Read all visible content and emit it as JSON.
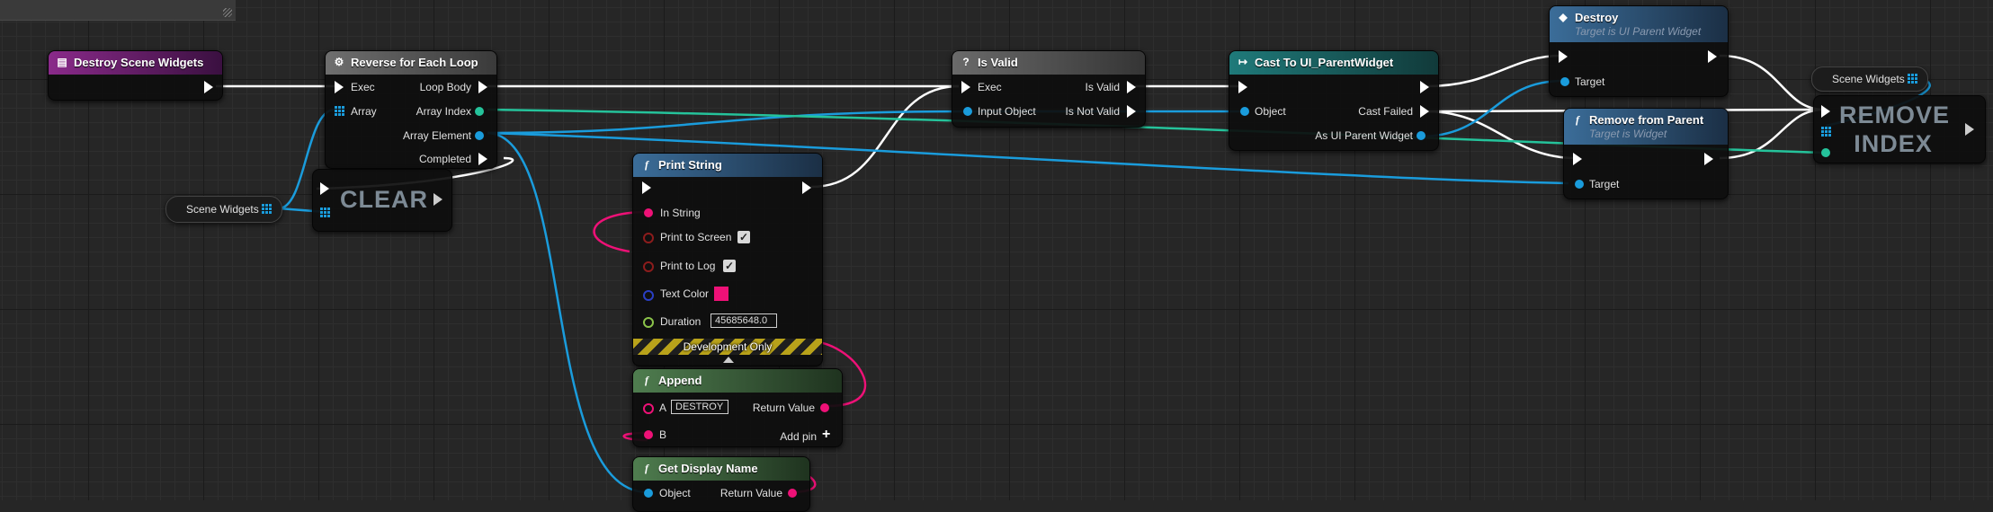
{
  "colors": {
    "event_header": "#7a1d7a",
    "function_header": "#2f5f88",
    "macro_header": "#666666",
    "pure_header": "#4a7a4a",
    "cast_header": "#1c6f6f",
    "object_pin": "#1a9cdc",
    "int_pin": "#25c39b",
    "string_pin": "#ee1177",
    "bool_pin": "#8c1c1c",
    "color_pin": "#2a3fc4",
    "float_pin": "#8bc34a"
  },
  "graph": {
    "destroy_event": {
      "title": "Destroy Scene Widgets",
      "icon": "event-icon"
    },
    "foreach": {
      "title": "Reverse for Each Loop",
      "icon": "macro-icon",
      "exec": "Exec",
      "array": "Array",
      "loop_body": "Loop Body",
      "array_index": "Array Index",
      "array_element": "Array Element",
      "completed": "Completed"
    },
    "scene_widgets_get": {
      "label": "Scene Widgets"
    },
    "clear": {
      "label": "CLEAR"
    },
    "is_valid": {
      "title": "Is Valid",
      "icon": "?",
      "exec": "Exec",
      "input_object": "Input Object",
      "out_valid": "Is Valid",
      "out_invalid": "Is Not Valid"
    },
    "cast": {
      "title": "Cast To UI_ParentWidget",
      "object": "Object",
      "cast_failed": "Cast Failed",
      "as_widget": "As UI Parent Widget"
    },
    "destroy": {
      "title": "Destroy",
      "subtitle": "Target is UI Parent Widget",
      "target": "Target"
    },
    "remove_from_parent": {
      "title": "Remove from Parent",
      "subtitle": "Target is Widget",
      "target": "Target"
    },
    "scene_widgets_get2": {
      "label": "Scene Widgets"
    },
    "remove_index": {
      "line1": "REMOVE",
      "line2": "INDEX"
    },
    "print_string": {
      "title": "Print String",
      "in_string": "In String",
      "print_to_screen": "Print to Screen",
      "print_to_log": "Print to Log",
      "text_color": "Text Color",
      "duration": "Duration",
      "duration_value": "45685648.0",
      "development_only": "Development Only",
      "print_to_screen_checked": true,
      "print_to_log_checked": true
    },
    "append": {
      "title": "Append",
      "a_label": "A",
      "a_value": "DESTROY",
      "b_label": "B",
      "return_value": "Return Value",
      "add_pin": "Add pin"
    },
    "get_display_name": {
      "title": "Get Display Name",
      "object": "Object",
      "return_value": "Return Value"
    }
  }
}
